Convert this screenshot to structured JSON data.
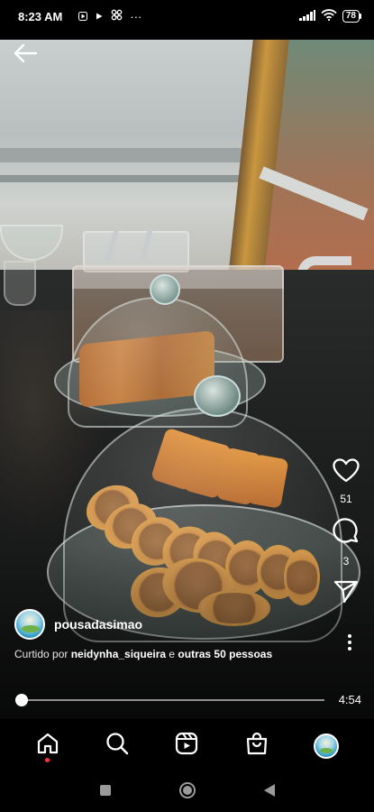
{
  "status_bar": {
    "time": "8:23 AM",
    "overflow": "···",
    "battery": "78",
    "icons": [
      "play-icon",
      "play-icon",
      "pinwheel-icon",
      "signal-icon",
      "wifi-icon",
      "battery-icon"
    ]
  },
  "header": {
    "back_icon": "arrow-left-icon"
  },
  "actions": {
    "like_count": "51",
    "comment_count": "3",
    "share_icon": "send-icon"
  },
  "post": {
    "username": "pousadasimao",
    "liked_prefix": "Curtido por ",
    "liked_user": "neidynha_siqueira",
    "liked_middle": " e ",
    "liked_others": "outras 50 pessoas",
    "more_icon": "more-vertical-icon"
  },
  "video": {
    "duration": "4:54",
    "progress": 0.0
  },
  "bottom_nav": {
    "items": [
      "home-icon",
      "search-icon",
      "reels-icon",
      "shop-icon",
      "profile-avatar"
    ]
  },
  "system_nav": {
    "items": [
      "recents-icon",
      "home-button-icon",
      "back-triangle-icon"
    ]
  },
  "colors": {
    "background": "#000000",
    "notification_dot": "#ff3040",
    "text": "#ffffff"
  }
}
